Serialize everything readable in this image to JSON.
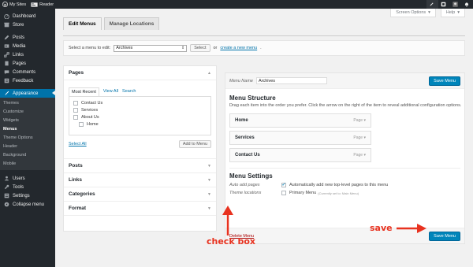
{
  "adminbar": {
    "my_sites": "My Sites",
    "reader": "Reader"
  },
  "sidebar": {
    "items": [
      {
        "label": "Dashboard",
        "icon": "dashboard-icon"
      },
      {
        "label": "Store",
        "icon": "store-icon"
      },
      {
        "label": "Posts",
        "icon": "posts-icon"
      },
      {
        "label": "Media",
        "icon": "media-icon"
      },
      {
        "label": "Links",
        "icon": "links-icon"
      },
      {
        "label": "Pages",
        "icon": "pages-icon"
      },
      {
        "label": "Comments",
        "icon": "comments-icon"
      },
      {
        "label": "Feedback",
        "icon": "feedback-icon"
      },
      {
        "label": "Appearance",
        "icon": "appearance-icon"
      }
    ],
    "appearance_sub": [
      "Themes",
      "Customize",
      "Widgets",
      "Menus",
      "Theme Options",
      "Header",
      "Background",
      "Mobile"
    ],
    "bottom_items": [
      {
        "label": "Users",
        "icon": "users-icon"
      },
      {
        "label": "Tools",
        "icon": "tools-icon"
      },
      {
        "label": "Settings",
        "icon": "settings-icon"
      },
      {
        "label": "Collapse menu",
        "icon": "collapse-icon"
      }
    ]
  },
  "screen_meta": {
    "screen_options": "Screen Options",
    "help": "Help"
  },
  "tabs": {
    "edit_menus": "Edit Menus",
    "manage_locations": "Manage Locations"
  },
  "manage": {
    "select_label": "Select a menu to edit:",
    "selected_menu": "Archives",
    "select_button": "Select",
    "or_text": "or",
    "create_link": "create a new menu"
  },
  "pages_box": {
    "title": "Pages",
    "tab_most_recent": "Most Recent",
    "tab_view_all": "View All",
    "tab_search": "Search",
    "items": [
      "Contact Us",
      "Services",
      "About Us",
      "Home"
    ],
    "select_all": "Select All",
    "add_to_menu": "Add to Menu"
  },
  "accordion": {
    "posts": "Posts",
    "links": "Links",
    "categories": "Categories",
    "format": "Format"
  },
  "menu_editor": {
    "menu_name_label": "Menu Name",
    "menu_name_value": "Archives",
    "save_label": "Save Menu",
    "structure_title": "Menu Structure",
    "instructions": "Drag each item into the order you prefer. Click the arrow on the right of the item to reveal additional configuration options.",
    "items": [
      {
        "title": "Home",
        "type": "Page"
      },
      {
        "title": "Services",
        "type": "Page"
      },
      {
        "title": "Contact Us",
        "type": "Page"
      }
    ],
    "settings_title": "Menu Settings",
    "auto_add_label": "Auto add pages",
    "auto_add_text": "Automatically add new top-level pages to this menu",
    "auto_add_checked": true,
    "theme_locations_label": "Theme locations",
    "primary_menu_text": "Primary Menu",
    "primary_menu_note": "(Currently set to: Main Menu)",
    "primary_menu_checked": false,
    "delete_link": "Delete Menu"
  },
  "annotations": {
    "check_box": "check box",
    "save": "save",
    "color": "#e8321f"
  }
}
